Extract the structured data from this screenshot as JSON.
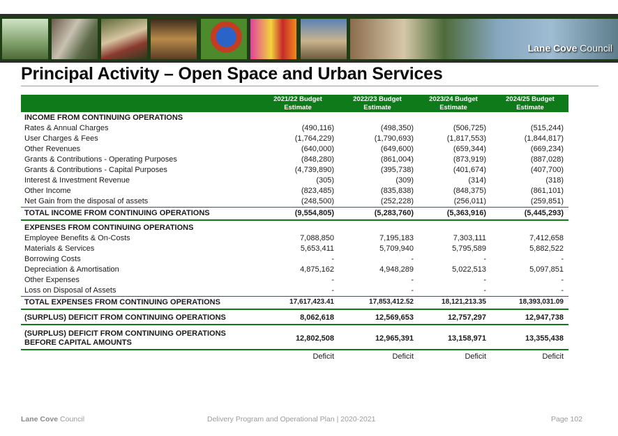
{
  "banner": {
    "brand_bold": "Lane Cove",
    "brand_light": "Council"
  },
  "title": "Principal Activity – Open Space and Urban Services",
  "columns": [
    {
      "line1": "2021/22 Budget",
      "line2": "Estimate"
    },
    {
      "line1": "2022/23 Budget",
      "line2": "Estimate"
    },
    {
      "line1": "2023/24 Budget",
      "line2": "Estimate"
    },
    {
      "line1": "2024/25 Budget",
      "line2": "Estimate"
    }
  ],
  "income": {
    "heading": "INCOME FROM CONTINUING OPERATIONS",
    "rows": [
      {
        "label": "Rates & Annual Charges",
        "values": [
          "(490,116)",
          "(498,350)",
          "(506,725)",
          "(515,244)"
        ]
      },
      {
        "label": "User Charges & Fees",
        "values": [
          "(1,764,229)",
          "(1,790,693)",
          "(1,817,553)",
          "(1,844,817)"
        ]
      },
      {
        "label": "Other Revenues",
        "values": [
          "(640,000)",
          "(649,600)",
          "(659,344)",
          "(669,234)"
        ]
      },
      {
        "label": "Grants & Contributions - Operating Purposes",
        "values": [
          "(848,280)",
          "(861,004)",
          "(873,919)",
          "(887,028)"
        ]
      },
      {
        "label": "Grants & Contributions - Capital Purposes",
        "values": [
          "(4,739,890)",
          "(395,738)",
          "(401,674)",
          "(407,700)"
        ]
      },
      {
        "label": "Interest & Investment Revenue",
        "values": [
          "(305)",
          "(309)",
          "(314)",
          "(318)"
        ]
      },
      {
        "label": "Other Income",
        "values": [
          "(823,485)",
          "(835,838)",
          "(848,375)",
          "(861,101)"
        ]
      },
      {
        "label": "Net Gain from the disposal of assets",
        "values": [
          "(248,500)",
          "(252,228)",
          "(256,011)",
          "(259,851)"
        ]
      }
    ],
    "total": {
      "label": "TOTAL INCOME FROM CONTINUING OPERATIONS",
      "values": [
        "(9,554,805)",
        "(5,283,760)",
        "(5,363,916)",
        "(5,445,293)"
      ]
    }
  },
  "expenses": {
    "heading": "EXPENSES FROM CONTINUING OPERATIONS",
    "rows": [
      {
        "label": "Employee Benefits & On-Costs",
        "values": [
          "7,088,850",
          "7,195,183",
          "7,303,111",
          "7,412,658"
        ]
      },
      {
        "label": "Materials & Services",
        "values": [
          "5,653,411",
          "5,709,940",
          "5,795,589",
          "5,882,522"
        ]
      },
      {
        "label": "Borrowing Costs",
        "values": [
          "-",
          "-",
          "-",
          "-"
        ]
      },
      {
        "label": "Depreciation & Amortisation",
        "values": [
          "4,875,162",
          "4,948,289",
          "5,022,513",
          "5,097,851"
        ]
      },
      {
        "label": "Other Expenses",
        "values": [
          "-",
          "-",
          "-",
          "-"
        ]
      },
      {
        "label": "Loss on Disposal of Assets",
        "values": [
          "-",
          "-",
          "-",
          "-"
        ]
      }
    ],
    "total": {
      "label": "TOTAL EXPENSES FROM CONTINUING OPERATIONS",
      "values": [
        "17,617,423.41",
        "17,853,412.52",
        "18,121,213.35",
        "18,393,031.09"
      ]
    }
  },
  "surplus": {
    "label": "(SURPLUS) DEFICIT FROM CONTINUING OPERATIONS",
    "values": [
      "8,062,618",
      "12,569,653",
      "12,757,297",
      "12,947,738"
    ]
  },
  "surplus_before_capital": {
    "label_line1": "(SURPLUS) DEFICIT FROM CONTINUING OPERATIONS",
    "label_line2": "BEFORE CAPITAL AMOUNTS",
    "values": [
      "12,802,508",
      "12,965,391",
      "13,158,971",
      "13,355,438"
    ]
  },
  "result": [
    "Deficit",
    "Deficit",
    "Deficit",
    "Deficit"
  ],
  "footer": {
    "brand_bold": "Lane Cove",
    "brand_light": "Council",
    "center": "Delivery Program and Operational Plan | 2020-2021",
    "page": "Page 102"
  }
}
